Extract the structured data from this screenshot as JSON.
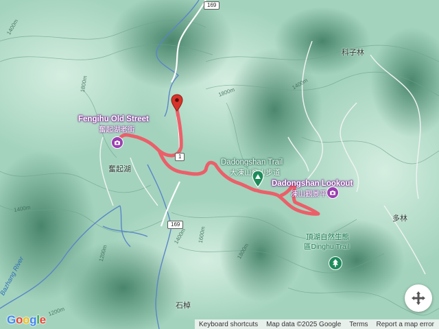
{
  "map": {
    "colors": {
      "trail": "#ef5864",
      "poi": "#9c3fb1",
      "green_pin": "#1e8b5a",
      "red_pin": "#d8332b"
    },
    "pois": {
      "fenqihu": {
        "name": "Fengihu Old Street",
        "sub": "奮起湖老街"
      },
      "dadongshan": {
        "name": "Dadongshan Trail",
        "sub": "大凍山登山步道"
      },
      "lookout": {
        "name": "Dadongshan Lookout",
        "sub": "凍山觀景平台"
      },
      "dinghu": {
        "name1": "頂湖自然生態",
        "name2": "區Dinghu Trail"
      }
    },
    "places": {
      "fenqihu_town": "奮起湖",
      "kezilin": "科子林",
      "duolin": "多林",
      "shizhang": "石棹",
      "river": "Bazhang River"
    },
    "roads": {
      "r169": "169",
      "r1": "1"
    },
    "contours": [
      "1400m",
      "1800m",
      "1400m",
      "1800m",
      "1200m",
      "1400m",
      "1600m",
      "1800m",
      "1400m",
      "1200m"
    ],
    "controls": {
      "camera_icon": "camera-control-icon"
    },
    "logo": "Google",
    "attribution": {
      "shortcuts": "Keyboard shortcuts",
      "map_data": "Map data ©2025 Google",
      "terms": "Terms",
      "report": "Report a map error"
    }
  }
}
